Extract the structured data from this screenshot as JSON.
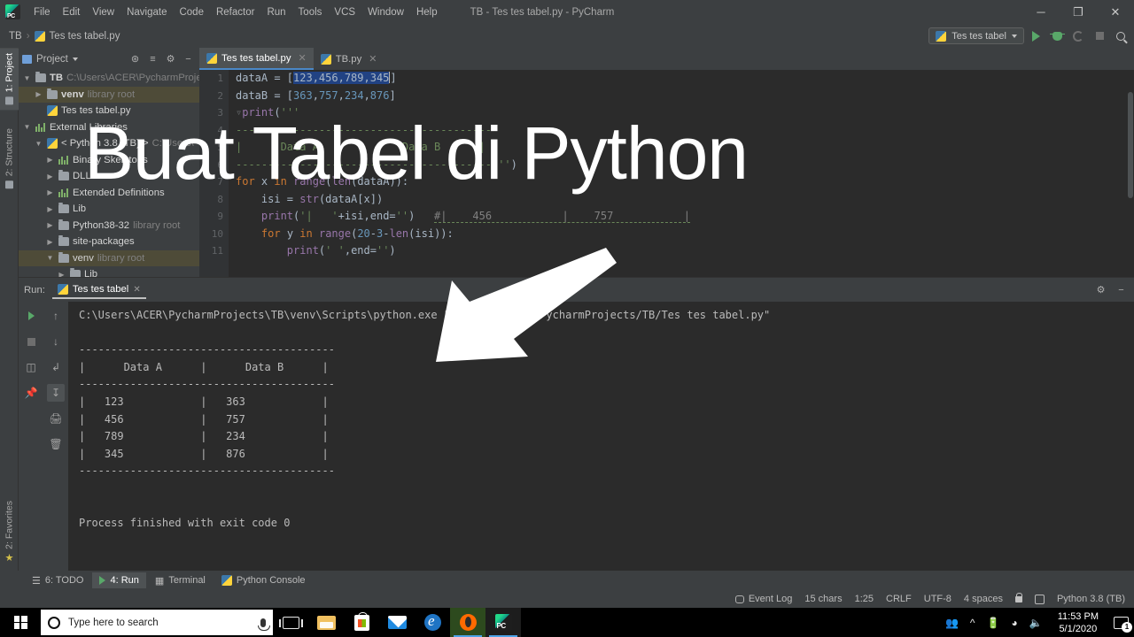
{
  "window": {
    "title": "TB - Tes tes tabel.py - PyCharm",
    "minimize": "─",
    "maximize": "❐",
    "close": "✕"
  },
  "menubar": {
    "logo": "pycharm-logo-icon",
    "items": [
      "File",
      "Edit",
      "View",
      "Navigate",
      "Code",
      "Refactor",
      "Run",
      "Tools",
      "VCS",
      "Window",
      "Help"
    ]
  },
  "navbar": {
    "breadcrumb_project": "TB",
    "breadcrumb_sep": "›",
    "breadcrumb_file": "Tes tes tabel.py",
    "run_config": "Tes tes tabel",
    "buttons": [
      "run-button",
      "debug-button",
      "rerun-button",
      "stop-button",
      "search-everywhere-button"
    ]
  },
  "left_strip": {
    "tabs": [
      {
        "label": "1: Project",
        "active": true
      },
      {
        "label": "2: Structure",
        "active": false
      },
      {
        "label": "2: Favorites",
        "active": false
      }
    ]
  },
  "project_panel": {
    "title": "Project",
    "header_icons": [
      "target-icon",
      "collapse-all-icon",
      "gear-icon",
      "hide-icon"
    ],
    "tree": [
      {
        "indent": 0,
        "arrow": "▼",
        "icon": "folder",
        "label": "TB",
        "bold": true,
        "hint": "C:\\Users\\ACER\\PycharmProje",
        "selected": false
      },
      {
        "indent": 1,
        "arrow": "▶",
        "icon": "folder",
        "label": "venv",
        "bold": true,
        "hint": "library root",
        "selected": true
      },
      {
        "indent": 1,
        "arrow": "",
        "icon": "python-file",
        "label": "Tes tes tabel.py",
        "bold": false,
        "hint": "",
        "selected": false
      },
      {
        "indent": 0,
        "arrow": "▼",
        "icon": "bars",
        "label": "External Libraries",
        "bold": false,
        "hint": "",
        "selected": false
      },
      {
        "indent": 1,
        "arrow": "▼",
        "icon": "python-file",
        "label": "< Python 3.8 (TB) >",
        "bold": false,
        "hint": "C:\\Users\\",
        "selected": false
      },
      {
        "indent": 2,
        "arrow": "▶",
        "icon": "bars",
        "label": "Binary Skeletons",
        "bold": false,
        "hint": "",
        "selected": false
      },
      {
        "indent": 2,
        "arrow": "▶",
        "icon": "folder",
        "label": "DLLs",
        "bold": false,
        "hint": "",
        "selected": false
      },
      {
        "indent": 2,
        "arrow": "▶",
        "icon": "bars",
        "label": "Extended Definitions",
        "bold": false,
        "hint": "",
        "selected": false
      },
      {
        "indent": 2,
        "arrow": "▶",
        "icon": "folder",
        "label": "Lib",
        "bold": false,
        "hint": "",
        "selected": false
      },
      {
        "indent": 2,
        "arrow": "▶",
        "icon": "folder",
        "label": "Python38-32",
        "bold": false,
        "hint": "library root",
        "selected": false
      },
      {
        "indent": 2,
        "arrow": "▶",
        "icon": "folder",
        "label": "site-packages",
        "bold": false,
        "hint": "",
        "selected": false
      },
      {
        "indent": 2,
        "arrow": "▼",
        "icon": "folder",
        "label": "venv",
        "bold": false,
        "hint": "library root",
        "selected": true
      },
      {
        "indent": 3,
        "arrow": "▶",
        "icon": "folder",
        "label": "Lib",
        "bold": false,
        "hint": "",
        "selected": false
      }
    ]
  },
  "editor": {
    "tabs": [
      {
        "label": "Tes tes tabel.py",
        "active": true,
        "close": "✕"
      },
      {
        "label": "TB.py",
        "active": false,
        "close": "✕"
      }
    ],
    "line_numbers": [
      "1",
      "2",
      "3",
      "4",
      "5",
      "6",
      "7",
      "8",
      "9",
      "10",
      "11"
    ],
    "lines": [
      "dataA = [123,456,789,345]",
      "dataB = [363,757,234,876]",
      "print('''",
      "----------------------------------------",
      "|      Data A      |      Data B      |",
      "----------------------------------------''')",
      "for x in range(len(dataA)):",
      "    isi = str(dataA[x])",
      "    print('|   '+isi,end='')   #|    456           |    757           |",
      "    for y in range(20-3-len(isi)):",
      "        print(' ',end='')"
    ],
    "selected_text": "123,456,789,345"
  },
  "run_window": {
    "label": "Run:",
    "tab": "Tes tes tabel",
    "tab_close": "✕",
    "toolbar_icons": [
      "rerun-button",
      "stop-button",
      "dump-threads-button",
      "pin-tab-button",
      "up-stack-button",
      "down-stack-button",
      "soft-wrap-button",
      "scroll-to-end-button",
      "print-button",
      "clear-all-button"
    ],
    "settings_icon": "gear-icon",
    "hide_icon": "hide-icon",
    "console": "C:\\Users\\ACER\\PycharmProjects\\TB\\venv\\Scripts\\python.exe \"C:/Users/ACER/PycharmProjects/TB/Tes tes tabel.py\"\n\n----------------------------------------\n|      Data A      |      Data B      |\n----------------------------------------\n|   123            |   363            |\n|   456            |   757            |\n|   789            |   234            |\n|   345            |   876            |\n----------------------------------------\n\n\nProcess finished with exit code 0"
  },
  "bottom_tabs": [
    {
      "label": "6: TODO",
      "icon": "todo-icon",
      "active": false
    },
    {
      "label": "4: Run",
      "icon": "run-icon",
      "active": true
    },
    {
      "label": "Terminal",
      "icon": "terminal-icon",
      "active": false
    },
    {
      "label": "Python Console",
      "icon": "python-icon",
      "active": false
    }
  ],
  "statusbar": {
    "event_log": "Event Log",
    "chars": "15 chars",
    "caret": "1:25",
    "line_sep": "CRLF",
    "encoding": "UTF-8",
    "indent": "4 spaces",
    "interpreter": "Python 3.8 (TB)"
  },
  "taskbar": {
    "start": "windows-start-icon",
    "search_placeholder": "Type here to search",
    "mic": "microphone-icon",
    "task_view": "task-view-icon",
    "apps": [
      {
        "name": "file-explorer",
        "active": false
      },
      {
        "name": "microsoft-store",
        "active": false
      },
      {
        "name": "mail",
        "active": false
      },
      {
        "name": "microsoft-edge",
        "active": false
      },
      {
        "name": "obs-studio",
        "active": true
      },
      {
        "name": "pycharm",
        "active": true
      }
    ],
    "tray": [
      "people-icon",
      "show-hidden-icons-icon",
      "battery-icon",
      "wifi-icon",
      "volume-icon"
    ],
    "time": "11:53 PM",
    "date": "5/1/2020",
    "notification_count": "1"
  },
  "overlay": {
    "title": "Buat Tabel di Python",
    "arrow": "arrow-pointing-down-left"
  }
}
